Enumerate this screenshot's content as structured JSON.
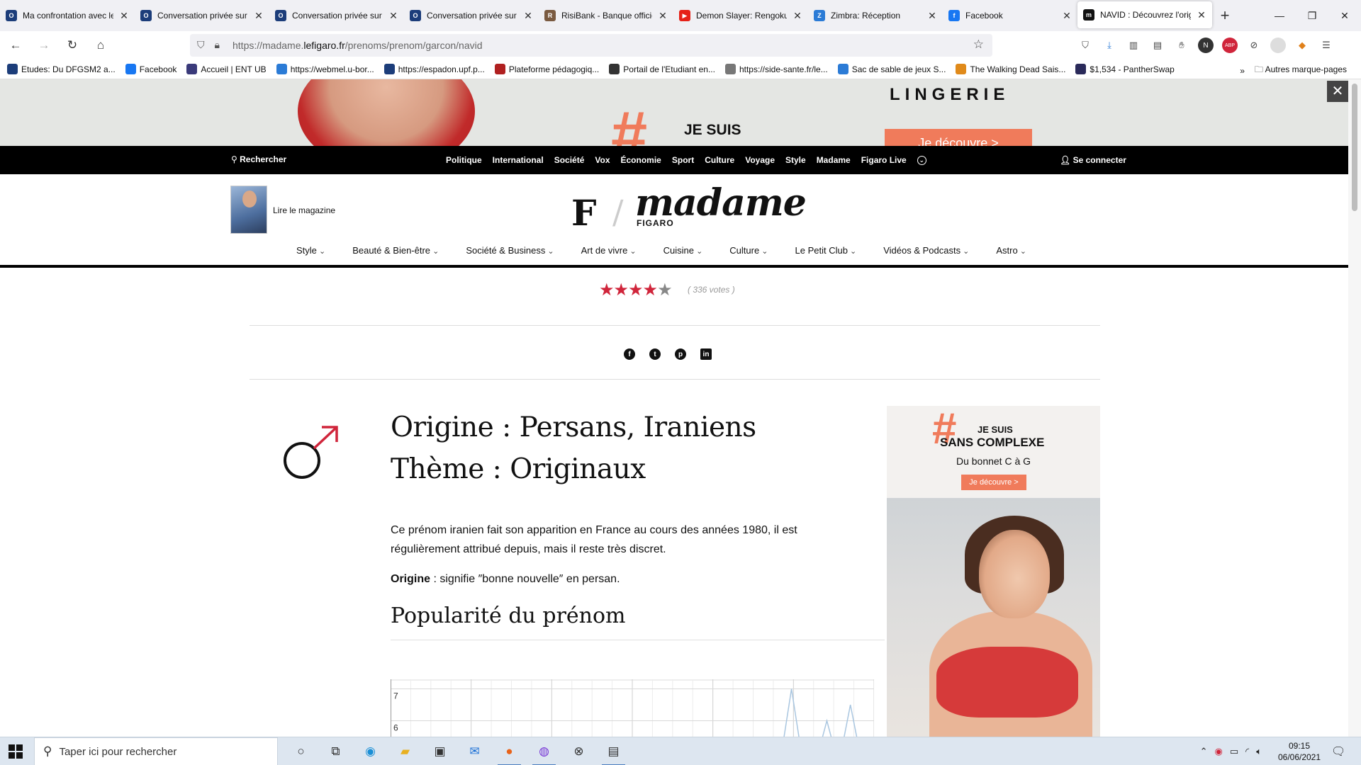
{
  "tabs": [
    {
      "label": "Ma confrontation avec le",
      "fav": "ofb",
      "color": "#1c3d7a"
    },
    {
      "label": "Conversation privée sur J",
      "fav": "ofb",
      "color": "#1c3d7a"
    },
    {
      "label": "Conversation privée sur J",
      "fav": "ofb",
      "color": "#1c3d7a"
    },
    {
      "label": "Conversation privée sur J",
      "fav": "ofb",
      "color": "#1c3d7a"
    },
    {
      "label": "RisiBank - Banque officie",
      "fav": "rb",
      "color": "#7a5a40"
    },
    {
      "label": "Demon Slayer: Rengoku",
      "fav": "yt",
      "color": "#e62117"
    },
    {
      "label": "Zimbra: Réception",
      "fav": "Z",
      "color": "#2b7bd6"
    },
    {
      "label": "Facebook",
      "fav": "f",
      "color": "#1877f2"
    },
    {
      "label": "NAVID : Découvrez l'origi",
      "fav": "m",
      "color": "#111111"
    }
  ],
  "browser": {
    "url_host_prefix": "https://madame.",
    "url_host": "lefigaro.fr",
    "url_path": "/prenoms/prenom/garcon/navid"
  },
  "bookmarks": [
    {
      "label": "Etudes: Du DFGSM2 a...",
      "color": "#1c3d7a"
    },
    {
      "label": "Facebook",
      "color": "#1877f2"
    },
    {
      "label": "Accueil | ENT UB",
      "color": "#3a3a7a"
    },
    {
      "label": "https://webmel.u-bor...",
      "color": "#2b7bd6"
    },
    {
      "label": "https://espadon.upf.p...",
      "color": "#1c3d7a"
    },
    {
      "label": "Plateforme pédagogiq...",
      "color": "#b02020"
    },
    {
      "label": "Portail de l'Etudiant en...",
      "color": "#333333"
    },
    {
      "label": "https://side-sante.fr/le...",
      "color": "#777777"
    },
    {
      "label": "Sac de sable de jeux S...",
      "color": "#2b7bd6"
    },
    {
      "label": "The Walking Dead Sais...",
      "color": "#e08a1a"
    },
    {
      "label": "$1,534 - PantherSwap",
      "color": "#2a2a5a"
    }
  ],
  "bookmarks_more": "Autres marque-pages",
  "top_ad": {
    "hash": "#",
    "je_suis": "JE SUIS",
    "brand": "LINGERIE",
    "cta": "Je découvre >",
    "close": "✕"
  },
  "site_nav": {
    "search": "Rechercher",
    "links": [
      "Politique",
      "International",
      "Société",
      "Vox",
      "Économie",
      "Sport",
      "Culture",
      "Voyage",
      "Style",
      "Madame",
      "Figaro Live"
    ],
    "login": "Se connecter"
  },
  "header": {
    "read_magazine": "Lire le magazine",
    "logo_f": "F",
    "logo_madame": "madame",
    "logo_figaro": "FIGARO"
  },
  "categories": [
    "Style",
    "Beauté & Bien-être",
    "Société & Business",
    "Art de vivre",
    "Cuisine",
    "Culture",
    "Le Petit Club",
    "Vidéos & Podcasts",
    "Astro"
  ],
  "rating": {
    "stars_on": 4,
    "stars_total": 5,
    "votes": "( 336 votes )"
  },
  "name_info": {
    "origine_line": "Origine : Persans, Iraniens",
    "theme_line": "Thème : Originaux",
    "description": "Ce prénom iranien fait son apparition en France au cours des années 1980, il est régulièrement attribué depuis, mais il reste très discret.",
    "origin_label": "Origine",
    "origin_text": " : signifie ″bonne nouvelle″ en persan.",
    "popularity_title": "Popularité du prénom",
    "chart_color": "#a9c6e0",
    "gender_color": "#d0253b"
  },
  "chart_data": {
    "type": "line",
    "title": "",
    "xlabel": "",
    "ylabel": "",
    "y_ticks_visible": [
      7,
      6
    ],
    "ylim": [
      5.5,
      7.3
    ],
    "x": [
      0,
      1,
      2,
      3,
      4,
      5,
      6,
      7,
      8,
      9,
      10,
      11,
      12,
      13,
      14,
      15,
      16,
      17,
      18,
      19,
      20,
      21,
      22,
      23,
      24,
      25,
      26,
      27,
      28,
      29,
      30,
      31,
      32,
      33,
      34,
      35,
      36,
      37,
      38,
      39,
      40,
      41
    ],
    "values": [
      0,
      0,
      0,
      0,
      0,
      0,
      0,
      0,
      0,
      0,
      0,
      0,
      0,
      0,
      0,
      0,
      0,
      0,
      0,
      0,
      0,
      0,
      0,
      0,
      0,
      0,
      0,
      0,
      0,
      0,
      0,
      0,
      0,
      0,
      7,
      0,
      0,
      6,
      0,
      6.5,
      0,
      0
    ],
    "grid": true
  },
  "side_ad": {
    "hash": "#",
    "je_suis": "JE SUIS",
    "sans_complexe": "SANS COMPLEXE",
    "bonnet": "Du bonnet C à G",
    "cta": "Je découvre >"
  },
  "taskbar": {
    "search_placeholder": "Taper ici pour rechercher",
    "time": "09:15",
    "date": "06/06/2021"
  }
}
